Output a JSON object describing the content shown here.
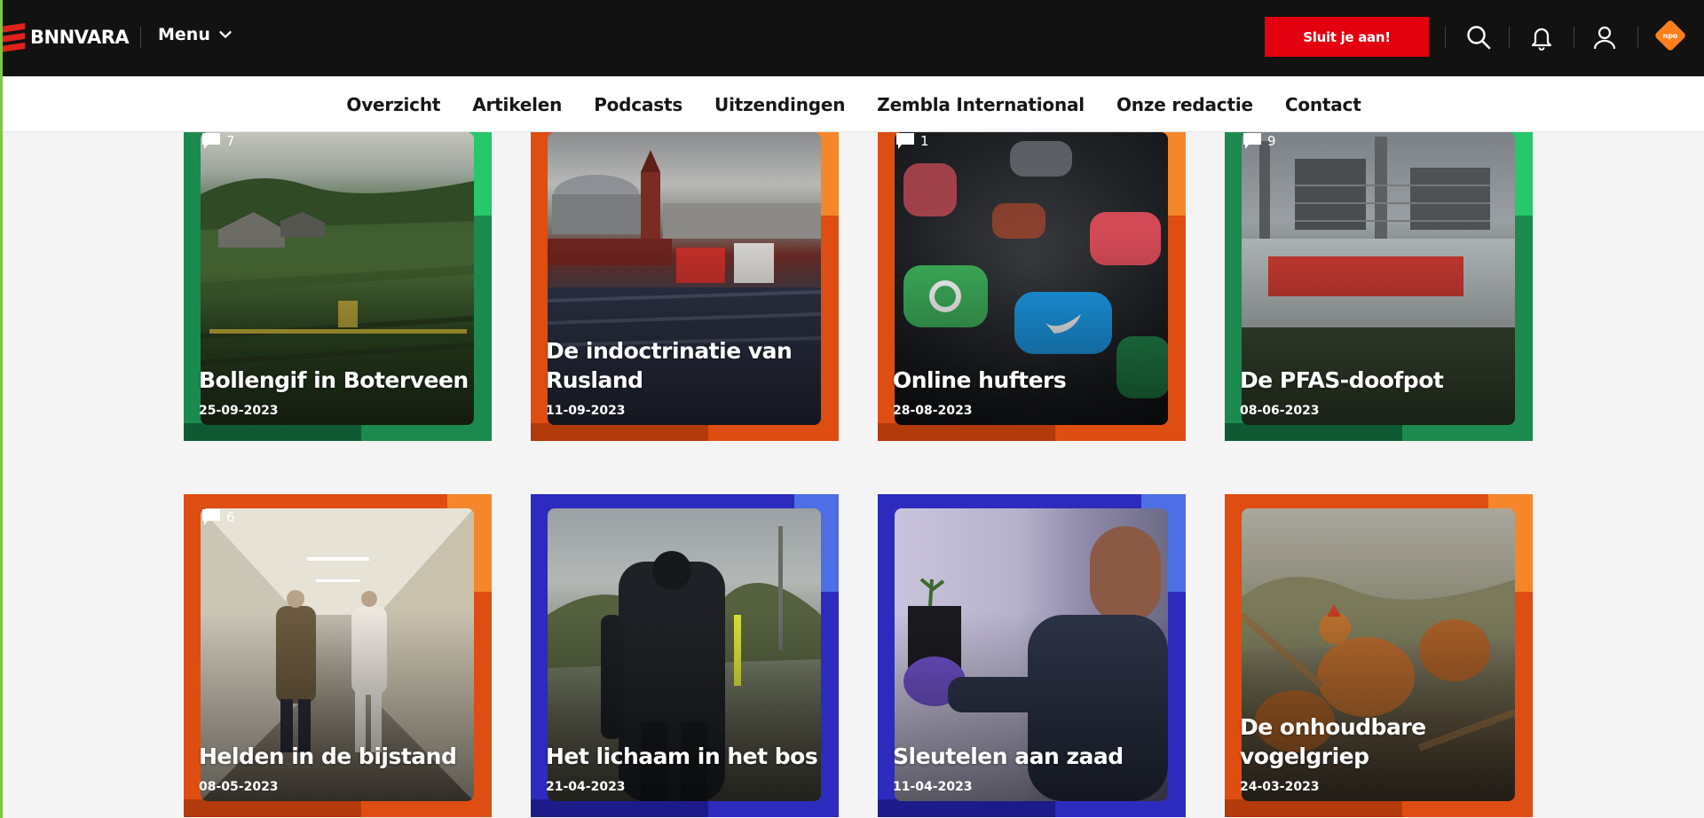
{
  "header": {
    "logo_text": "BNNVARA",
    "menu_label": "Menu",
    "join_label": "Sluit je aan!",
    "npo_label": "npo",
    "icons": [
      "search-icon",
      "bell-icon",
      "user-icon"
    ],
    "brand_color": "#e3000f"
  },
  "subnav": {
    "items": [
      "Overzicht",
      "Artikelen",
      "Podcasts",
      "Uitzendingen",
      "Zembla International",
      "Onze redactie",
      "Contact"
    ]
  },
  "cards": [
    {
      "title": "Bollengif in Boterveen",
      "date": "25-09-2023",
      "comments": "7",
      "theme": "green"
    },
    {
      "title": "De indoctrinatie van Rusland",
      "date": "11-09-2023",
      "comments": "",
      "theme": "orange"
    },
    {
      "title": "Online hufters",
      "date": "28-08-2023",
      "comments": "1",
      "theme": "orange"
    },
    {
      "title": "De PFAS-doofpot",
      "date": "08-06-2023",
      "comments": "9",
      "theme": "green"
    },
    {
      "title": "Helden in de bijstand",
      "date": "08-05-2023",
      "comments": "6",
      "theme": "orange"
    },
    {
      "title": "Het lichaam in het bos",
      "date": "21-04-2023",
      "comments": "",
      "theme": "blue"
    },
    {
      "title": "Sleutelen aan zaad",
      "date": "11-04-2023",
      "comments": "",
      "theme": "blue"
    },
    {
      "title": "De onhoudbare vogelgriep",
      "date": "24-03-2023",
      "comments": "",
      "theme": "orange"
    }
  ]
}
